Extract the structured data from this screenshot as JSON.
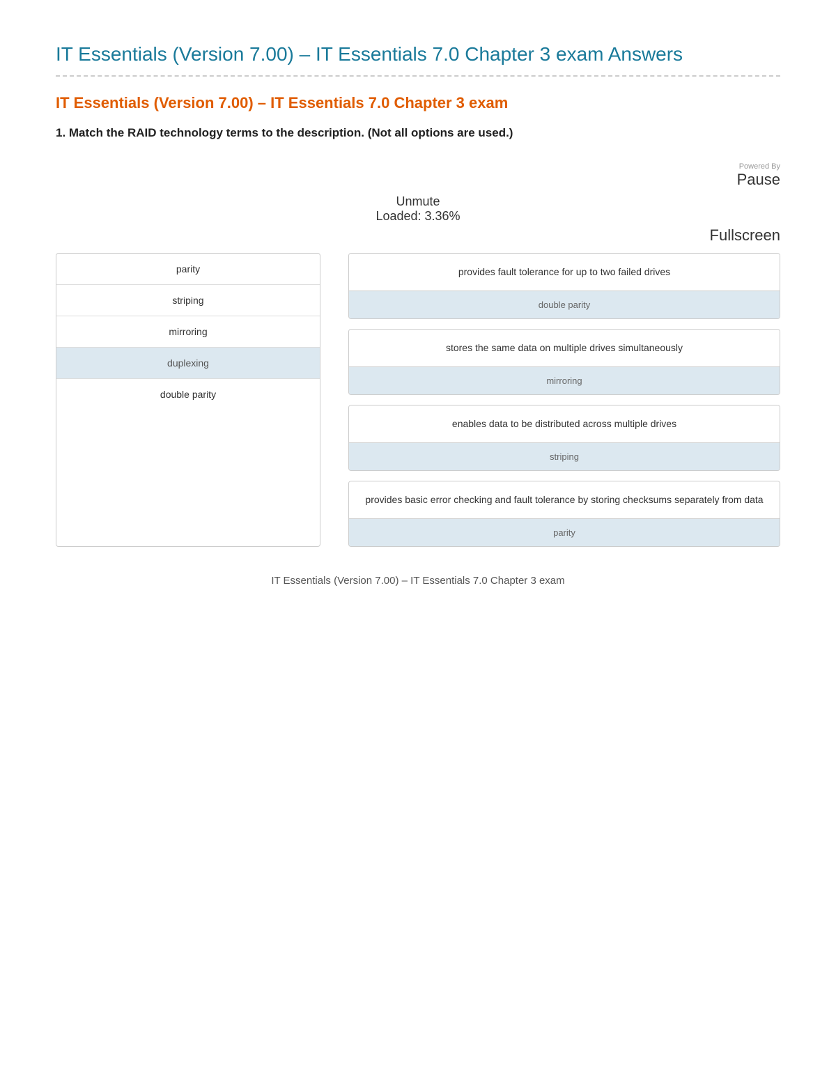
{
  "page": {
    "title": "IT Essentials (Version 7.00) – IT Essentials 7.0 Chapter 3 exam Answers",
    "section_title": "IT Essentials (Version 7.00) – IT Essentials 7.0 Chapter 3 exam",
    "question": "1. Match the RAID technology terms to the description. (Not all options are used.)"
  },
  "media": {
    "powered_by": "Powered By",
    "pause": "Pause",
    "unmute": "Unmute",
    "loaded": "Loaded: 3.36%",
    "fullscreen": "Fullscreen"
  },
  "left_column": {
    "items": [
      {
        "label": "parity",
        "highlighted": false
      },
      {
        "label": "striping",
        "highlighted": false
      },
      {
        "label": "mirroring",
        "highlighted": false
      },
      {
        "label": "duplexing",
        "highlighted": true
      },
      {
        "label": "double parity",
        "highlighted": false
      }
    ]
  },
  "right_column": {
    "boxes": [
      {
        "description": "provides fault tolerance for up to two failed drives",
        "answer": "double parity"
      },
      {
        "description": "stores the same data on multiple drives simultaneously",
        "answer": "mirroring"
      },
      {
        "description": "enables data to be distributed across multiple drives",
        "answer": "striping"
      },
      {
        "description": "provides basic error checking and fault tolerance by storing checksums separately from data",
        "answer": "parity"
      }
    ]
  },
  "footer": {
    "text": "IT Essentials (Version 7.00) – IT Essentials 7.0 Chapter 3 exam"
  }
}
